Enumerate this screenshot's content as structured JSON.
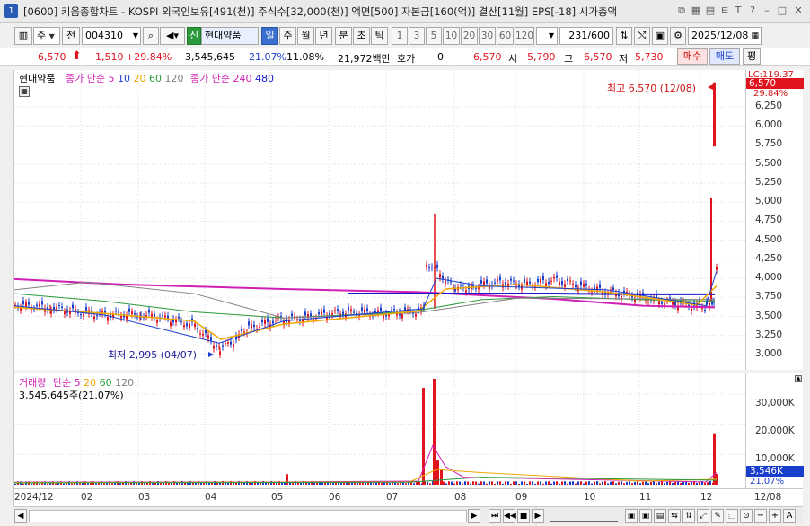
{
  "window": {
    "number": "1",
    "title": "[0600] 키움종합차트 - KOSPI 외국인보유[491(천)] 주식수[32,000(천)] 액면[500] 자본금[160(억)] 결산[11월] EPS[-18] 시가총액"
  },
  "toolbar": {
    "type_select": "주",
    "jeon_button": "전",
    "stock_code": "004310",
    "credit_badge": "신",
    "stock_name": "현대약품",
    "periods": [
      "일",
      "주",
      "월",
      "년",
      "분",
      "초",
      "틱"
    ],
    "intervals": [
      "1",
      "3",
      "5",
      "10",
      "20",
      "30",
      "60",
      "120"
    ],
    "count": "231",
    "count_total": "/600",
    "date": "2025/12/08"
  },
  "quote": {
    "price": "6,570",
    "change": "1,510",
    "change_pct": "+29.84%",
    "volume": "3,545,645",
    "volume_ratio": "21.07%",
    "turnover": "11.08%",
    "amount": "21,972백만",
    "hoga_label": "호가",
    "hoga_value": "0",
    "price2": "6,570",
    "open_label": "시",
    "open": "5,790",
    "high_label": "고",
    "high": "6,570",
    "low_label": "저",
    "low": "5,730",
    "buy_button": "매수",
    "sell_button": "매도",
    "eval_button": "평"
  },
  "price_legend": {
    "name": "현대약품",
    "ma_label1": "종가 단순",
    "ma_periods1": [
      "5",
      "10",
      "20",
      "60",
      "120"
    ],
    "ma_label2": "종가 단순",
    "ma_periods2": [
      "240",
      "480"
    ]
  },
  "annotations": {
    "high": "최고 6,570 (12/08)",
    "low": "최저 2,995 (04/07)"
  },
  "price_axis": {
    "top_label": "LC:119.37",
    "current_price": "6,570",
    "current_pct": "29.84%",
    "ticks": [
      "6,250",
      "6,000",
      "5,750",
      "5,500",
      "5,250",
      "5,000",
      "4,750",
      "4,500",
      "4,250",
      "4,000",
      "3,750",
      "3,500",
      "3,250",
      "3,000"
    ]
  },
  "volume_legend": {
    "label": "거래량",
    "ma_label": "단순",
    "ma_periods": [
      "5",
      "20",
      "60",
      "120"
    ],
    "current": "3,545,645주(21.07%)"
  },
  "volume_axis": {
    "ticks": [
      "30,000K",
      "20,000K",
      "10,000K"
    ],
    "current": "3,546K",
    "current_pct": "21.07%"
  },
  "x_axis": {
    "labels": [
      "2024/12",
      "02",
      "03",
      "04",
      "05",
      "06",
      "07",
      "08",
      "09",
      "10",
      "11",
      "12"
    ],
    "right_label": "12/08"
  },
  "colors": {
    "up": "#e0141e",
    "down": "#1a3ecc",
    "ma5": "#d01fb4",
    "ma10": "#1a3ecc",
    "ma20": "#f0a800",
    "ma60": "#2a9a3a",
    "ma120": "#808080",
    "ma240": "#d01fb4",
    "ma480": "#1a1acc"
  }
}
